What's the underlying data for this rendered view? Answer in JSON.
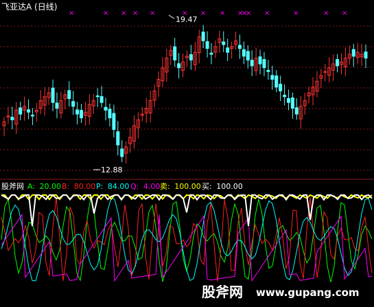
{
  "header": {
    "stock_title": "飞亚达A (日线)"
  },
  "indicator_bar": {
    "name": "股斧网",
    "items": [
      {
        "label": "A:",
        "value": "20.00",
        "color": "#00ff00"
      },
      {
        "label": "B:",
        "value": "80.00",
        "color": "#ff2020"
      },
      {
        "label": "P:",
        "value": "84.00",
        "color": "#00ffff"
      },
      {
        "label": "Q:",
        "value": "4.00",
        "color": "#ff00ff"
      },
      {
        "label": "卖:",
        "value": "100.00",
        "color": "#ffff00"
      },
      {
        "label": "买:",
        "value": "100.00",
        "color": "#ffffff"
      }
    ]
  },
  "watermark": {
    "text": "股斧网",
    "url": "www.gupang.com"
  },
  "colors": {
    "up_candle": "#ff3333",
    "down_candle": "#54ffff",
    "grid": "#8b1a1a",
    "marker": "#ff00ff",
    "bg": "#000000"
  },
  "chart_data": [
    {
      "type": "candlestick",
      "title": "飞亚达A (日线)",
      "annotations": [
        {
          "text": "19.47",
          "kind": "high"
        },
        {
          "text": "12.88",
          "kind": "low"
        }
      ],
      "ylim": [
        12.0,
        20.4
      ],
      "marker_symbol": "×",
      "marker_color": "#ff00ff",
      "marker_count": 15,
      "series_close_estimate": [
        14.8,
        15.1,
        14.9,
        15.4,
        15.2,
        15.6,
        15.3,
        15.1,
        15.4,
        15.9,
        16.1,
        16.3,
        15.8,
        15.5,
        15.9,
        16.2,
        16.0,
        15.6,
        15.2,
        15.0,
        15.3,
        15.7,
        15.9,
        16.1,
        15.8,
        15.4,
        15.0,
        14.4,
        13.6,
        13.0,
        13.5,
        14.0,
        14.6,
        14.9,
        15.2,
        15.5,
        15.9,
        16.4,
        17.0,
        17.6,
        18.1,
        18.5,
        18.0,
        17.6,
        17.9,
        18.2,
        18.0,
        18.4,
        19.2,
        19.0,
        18.6,
        18.3,
        18.7,
        19.1,
        18.8,
        18.4,
        18.7,
        19.0,
        18.6,
        18.2,
        18.0,
        17.7,
        18.1,
        17.8,
        17.6,
        17.4,
        17.0,
        16.6,
        16.4,
        16.1,
        15.8,
        15.5,
        15.2,
        15.6,
        15.9,
        16.3,
        16.6,
        16.9,
        17.2,
        17.4,
        17.6,
        17.8,
        17.7,
        17.9,
        18.1,
        18.3,
        18.2,
        18.4,
        18.3,
        18.1
      ]
    },
    {
      "type": "line",
      "title": "股斧网",
      "ylim": [
        0,
        100
      ],
      "series": [
        {
          "name": "A",
          "color": "#00ff00",
          "last": 20.0
        },
        {
          "name": "B",
          "color": "#ff2020",
          "last": 80.0
        },
        {
          "name": "P",
          "color": "#00ffff",
          "last": 84.0
        },
        {
          "name": "Q",
          "color": "#ff00ff",
          "last": 4.0
        },
        {
          "name": "卖",
          "color": "#ffff00",
          "last": 100.0
        },
        {
          "name": "买",
          "color": "#ffffff",
          "last": 100.0
        }
      ]
    }
  ]
}
